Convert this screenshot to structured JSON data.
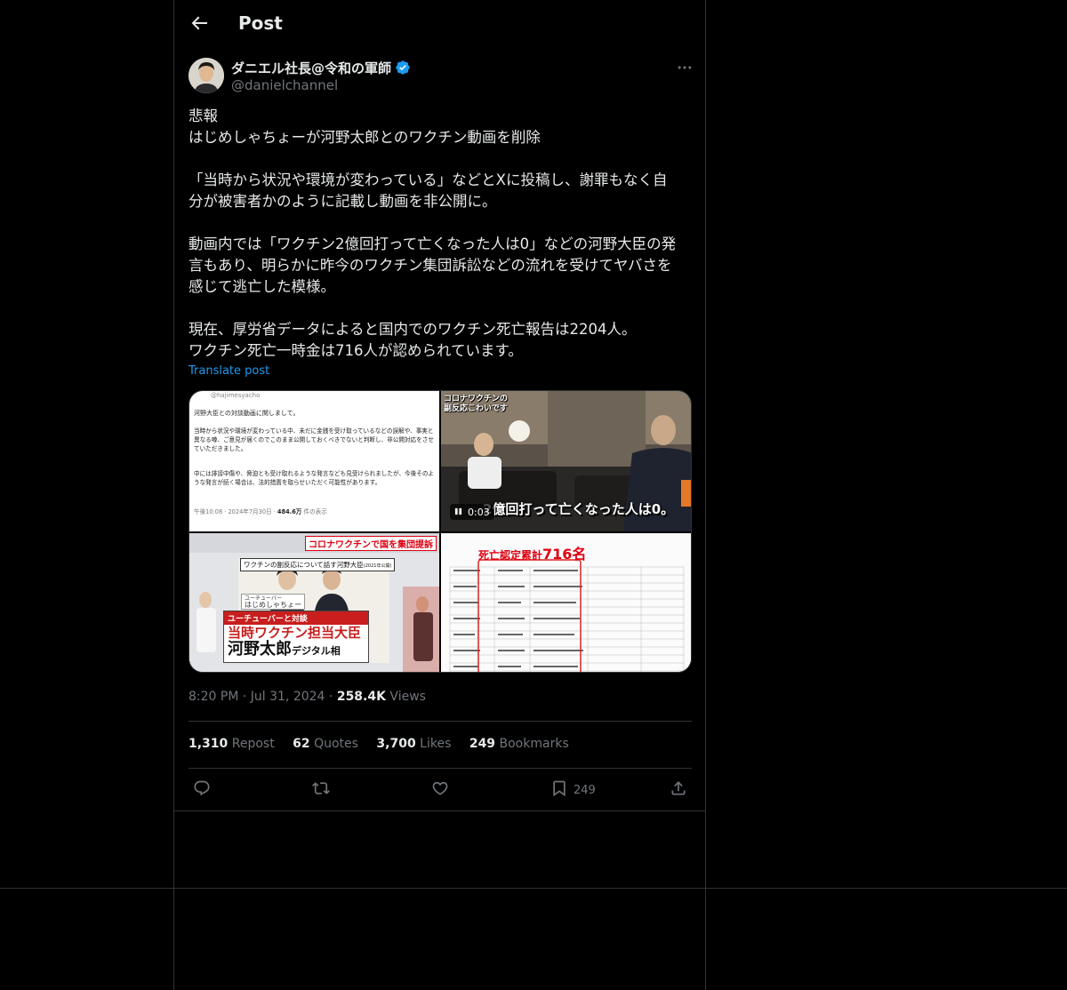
{
  "header": {
    "title": "Post"
  },
  "author": {
    "display_name": "ダニエル社長@令和の軍師",
    "handle": "@danielchannel",
    "verified": true
  },
  "post": {
    "text": "悲報\nはじめしゃちょーが河野太郎とのワクチン動画を削除\n\n「当時から状況や環境が変わっている」などとXに投稿し、謝罪もなく自\n分が被害者かのように記載し動画を非公開に。\n\n動画内では「ワクチン2億回打って亡くなった人は0」などの河野大臣の発\n言もあり、明らかに昨今のワクチン集団訴訟などの流れを受けてヤバさを\n感じて逃亡した模様。\n\n現在、厚労省データによると国内でのワクチン死亡報告は2204人。\nワクチン死亡一時金は716人が認められています。",
    "translate_label": "Translate post",
    "time": "8:20 PM",
    "date": "Jul 31, 2024",
    "views_count": "258.4K",
    "views_label": "Views"
  },
  "media": {
    "tile1": {
      "handle": "@hajimesyacho",
      "line1": "河野大臣との対談動画に関しまして。",
      "para1": "当時から状況や環境が変わっている中、未だに金銭を受け取っているなどの誤解や、事実と異なる噂、ご意見が届くのでこのまま公開しておくべきでないと判断し、非公開対応をさせていただきました。",
      "para2": "中には誹謗中傷や、脅迫とも受け取れるような発言なども見受けられましたが、今後そのような発言が続く場合は、法的措置を取らせいただく可能性があります。",
      "footer": "午後10:08 · 2024年7月30日 · ",
      "footer_views": "484.6万",
      "footer_suffix": " 件の表示"
    },
    "tile2": {
      "caption_top_1": "コロナワクチンの",
      "caption_top_2": "副反応こわいです",
      "caption_bottom": "2億回打って亡くなった人は0。",
      "video_time": "0:03"
    },
    "tile3": {
      "banner": "コロナワクチンで国を集団提訴",
      "subtitle": "ワクチンの副反応について話す河野大臣",
      "subtitle_year": "(2021年公開)",
      "name_tag_1": "ユーチューバー",
      "name_tag_2": "はじめしゃちょー",
      "caption_1": "ユーチューバーと対談",
      "caption_2": "当時ワクチン担当大臣",
      "caption_3": "河野太郎",
      "caption_3b": "デジタル相"
    },
    "tile4": {
      "title": "死亡認定累計",
      "count": "716名"
    }
  },
  "stats": {
    "reposts_count": "1,310",
    "reposts_label": "Repost",
    "quotes_count": "62",
    "quotes_label": "Quotes",
    "likes_count": "3,700",
    "likes_label": "Likes",
    "bookmarks_count": "249",
    "bookmarks_label": "Bookmarks"
  },
  "actions": {
    "bookmark_count": "249"
  },
  "colors": {
    "accent": "#1d9bf0",
    "muted": "#71767b",
    "border": "#2f3336",
    "text": "#e7e9ea"
  }
}
